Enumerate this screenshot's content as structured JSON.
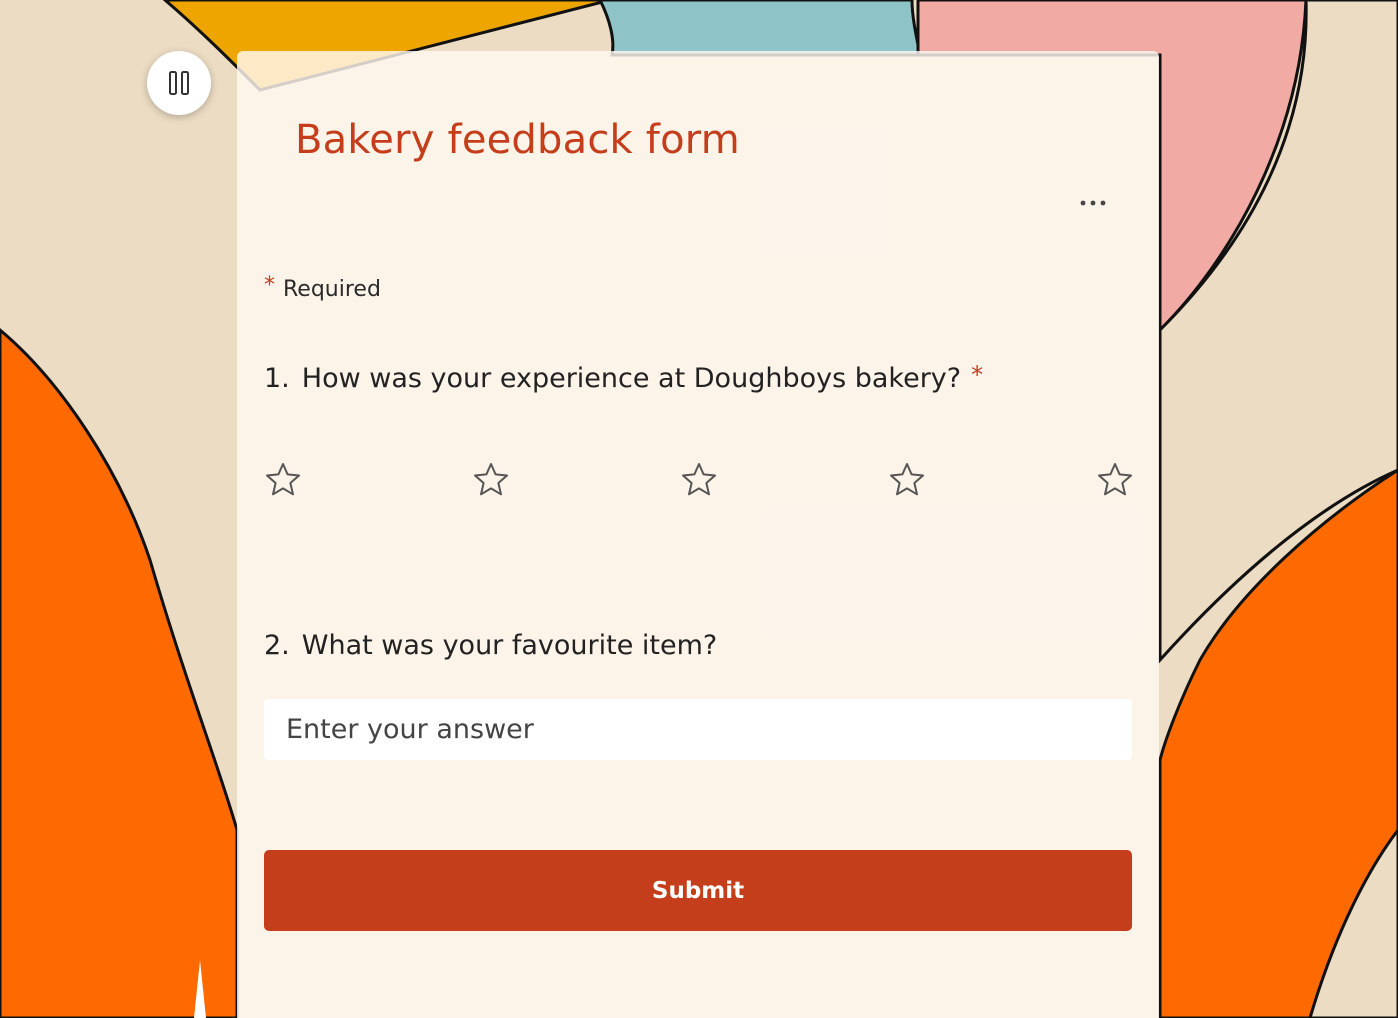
{
  "controls": {
    "pause_icon": "pause-icon",
    "more_icon": "more-options-icon"
  },
  "form": {
    "title": "Bakery feedback form",
    "required_asterisk": "*",
    "required_label": "Required",
    "questions": [
      {
        "number": "1.",
        "text": "How was your experience at Doughboys bakery?",
        "required_mark": "*",
        "type": "rating",
        "rating_max": 5,
        "rating_value": 0
      },
      {
        "number": "2.",
        "text": "What was your favourite item?",
        "type": "text",
        "placeholder": "Enter your answer",
        "value": ""
      }
    ],
    "submit_label": "Submit"
  },
  "colors": {
    "accent": "#c43e1c",
    "orange": "#ff6a00",
    "gold": "#eea500",
    "teal": "#8ec3c7",
    "pink": "#f2aaa5",
    "cream": "#ecdcc3"
  }
}
